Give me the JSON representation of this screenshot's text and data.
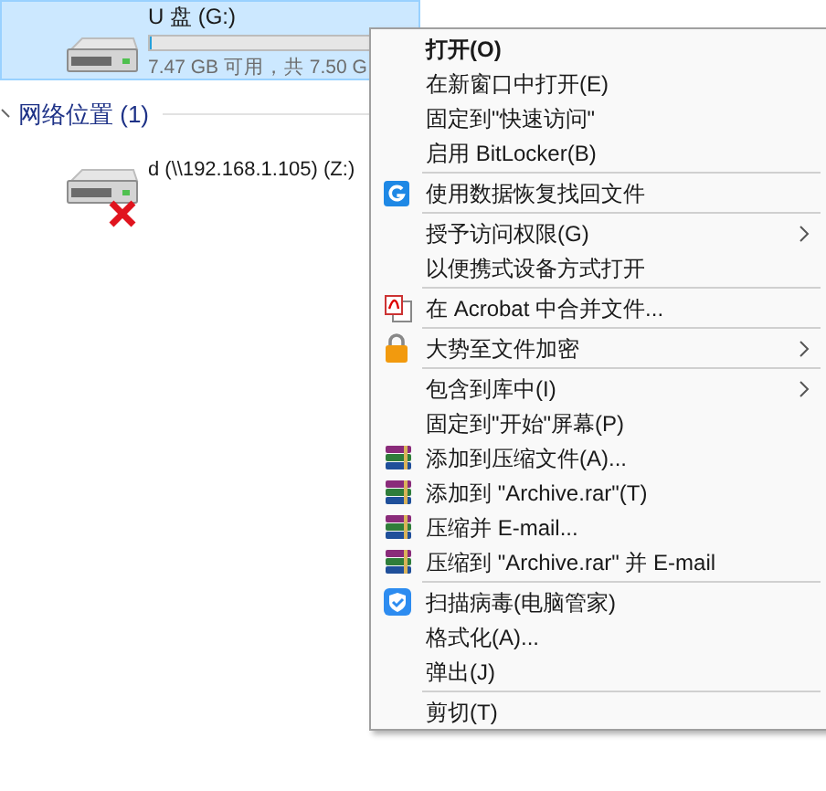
{
  "drives": [
    {
      "name": "U 盘 (G:)",
      "selected": true,
      "level": 0.01,
      "free": "7.47 GB 可用，共 7.50 G"
    }
  ],
  "network_section": {
    "title": "网络位置 (1)",
    "expanded": true,
    "items": [
      {
        "name": "d (\\\\192.168.1.105) (Z:)",
        "disconnected": true
      }
    ]
  },
  "context_menu": [
    {
      "kind": "item",
      "label": "打开(O)",
      "bold": true,
      "submenu": false
    },
    {
      "kind": "item",
      "label": "在新窗口中打开(E)",
      "bold": false,
      "submenu": false
    },
    {
      "kind": "item",
      "label": "固定到\"快速访问\"",
      "bold": false,
      "submenu": false
    },
    {
      "kind": "item",
      "label": "启用 BitLocker(B)",
      "bold": false,
      "submenu": false
    },
    {
      "kind": "separator"
    },
    {
      "kind": "recovery",
      "label": "使用数据恢复找回文件",
      "bold": false,
      "submenu": false
    },
    {
      "kind": "separator"
    },
    {
      "kind": "item",
      "label": "授予访问权限(G)",
      "bold": false,
      "submenu": true
    },
    {
      "kind": "item",
      "label": "以便携式设备方式打开",
      "bold": false,
      "submenu": false
    },
    {
      "kind": "separator"
    },
    {
      "kind": "acrobat",
      "label": "在 Acrobat 中合并文件...",
      "bold": false,
      "submenu": false
    },
    {
      "kind": "separator"
    },
    {
      "kind": "encryption",
      "label": "大势至文件加密",
      "bold": false,
      "submenu": true
    },
    {
      "kind": "separator"
    },
    {
      "kind": "item",
      "label": "包含到库中(I)",
      "bold": false,
      "submenu": true
    },
    {
      "kind": "item",
      "label": "固定到\"开始\"屏幕(P)",
      "bold": false,
      "submenu": false
    },
    {
      "kind": "archive",
      "label": "添加到压缩文件(A)...",
      "bold": false,
      "submenu": false
    },
    {
      "kind": "archive",
      "label": "添加到 \"Archive.rar\"(T)",
      "bold": false,
      "submenu": false
    },
    {
      "kind": "archive",
      "label": "压缩并 E-mail...",
      "bold": false,
      "submenu": false
    },
    {
      "kind": "archive",
      "label": "压缩到 \"Archive.rar\" 并 E-mail",
      "bold": false,
      "submenu": false
    },
    {
      "kind": "separator"
    },
    {
      "kind": "antivirus",
      "label": "扫描病毒(电脑管家)",
      "bold": false,
      "submenu": false
    },
    {
      "kind": "item",
      "label": "格式化(A)...",
      "bold": false,
      "submenu": false
    },
    {
      "kind": "item",
      "label": "弹出(J)",
      "bold": false,
      "submenu": false
    },
    {
      "kind": "separator"
    },
    {
      "kind": "item",
      "label": "剪切(T)",
      "bold": false,
      "submenu": false
    }
  ]
}
